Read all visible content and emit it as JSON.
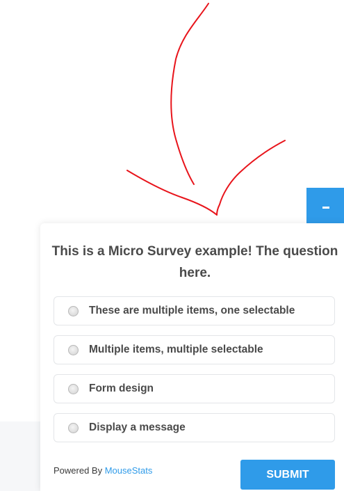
{
  "survey": {
    "question": "This is a Micro Survey example! The question here.",
    "options": [
      {
        "label": "These are multiple items, one selectable"
      },
      {
        "label": "Multiple items, multiple selectable"
      },
      {
        "label": "Form design"
      },
      {
        "label": "Display a message"
      }
    ],
    "submit_label": "SUBMIT",
    "powered_by_prefix": "Powered By",
    "powered_by_brand": "MouseStats"
  },
  "minimize_tab": {
    "icon": "minus-icon"
  },
  "colors": {
    "accent": "#2f9be9",
    "text": "#4a4a4a",
    "annotation": "#e8141b"
  }
}
